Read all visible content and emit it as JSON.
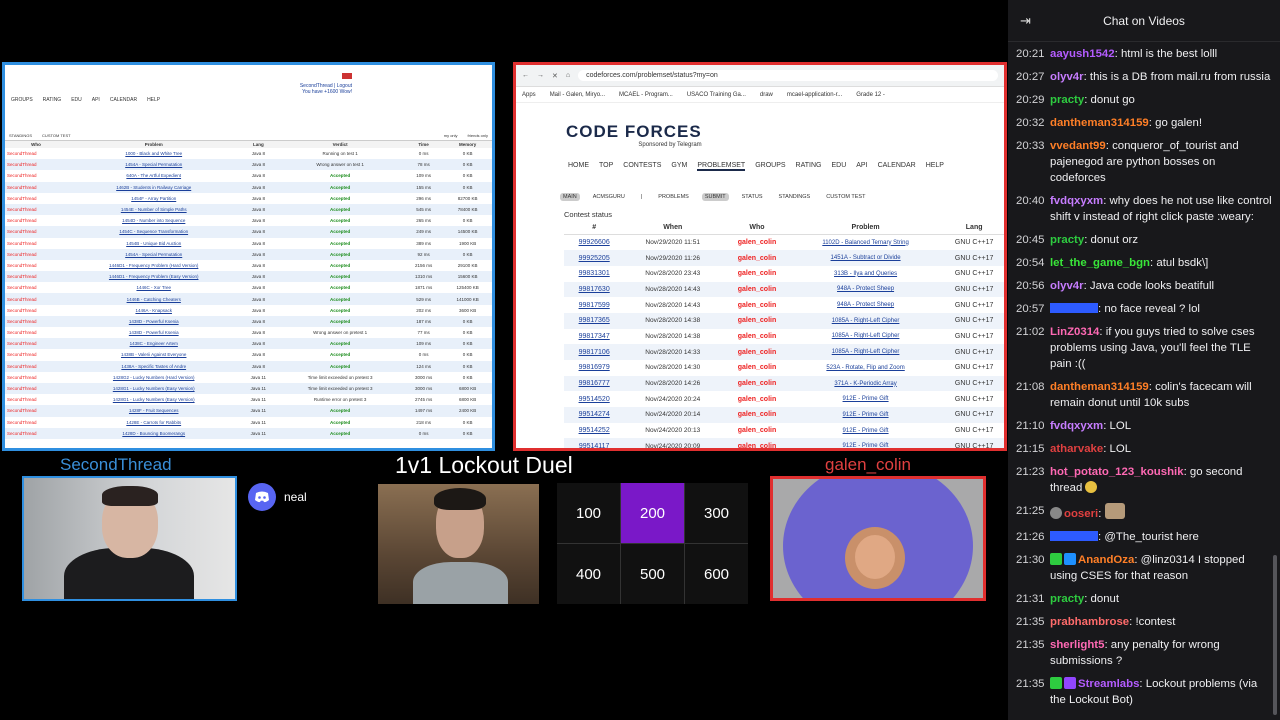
{
  "left_screen": {
    "nav": [
      "GROUPS",
      "RATING",
      "EDU",
      "API",
      "CALENDAR",
      "HELP"
    ],
    "user_lines": [
      "SecondThread | Logout",
      "You have +1600 Wow!"
    ],
    "subnav": [
      "STANDINGS",
      "CUSTOM TEST",
      "my only",
      "friends only"
    ],
    "headers": [
      "Who",
      "Problem",
      "Lang",
      "Verdict",
      "Time",
      "Memory"
    ],
    "rows": [
      [
        "SecondThread",
        "1000 - Black and White Tree",
        "Java 8",
        "Running on test 1",
        "0 ms",
        "0 KB"
      ],
      [
        "SecondThread",
        "1454A - Special Permutation",
        "Java 8",
        "Wrong answer on test 1",
        "78 ms",
        "0 KB"
      ],
      [
        "SecondThread",
        "640A - The Artful Expedient",
        "Java 8",
        "Accepted",
        "109 ms",
        "0 KB"
      ],
      [
        "SecondThread",
        "1462B - Students in Railway Carriage",
        "Java 8",
        "Accepted",
        "155 ms",
        "0 KB"
      ],
      [
        "SecondThread",
        "1454F - Array Partition",
        "Java 8",
        "Accepted",
        "296 ms",
        "82700 KB"
      ],
      [
        "SecondThread",
        "1454E - Number of Simple Paths",
        "Java 8",
        "Accepted",
        "545 ms",
        "78400 KB"
      ],
      [
        "SecondThread",
        "1454D - Number into Sequence",
        "Java 8",
        "Accepted",
        "265 ms",
        "0 KB"
      ],
      [
        "SecondThread",
        "1454C - Sequence Transformation",
        "Java 8",
        "Accepted",
        "249 ms",
        "14500 KB"
      ],
      [
        "SecondThread",
        "1454B - Unique Bid Auction",
        "Java 8",
        "Accepted",
        "389 ms",
        "1900 KB"
      ],
      [
        "SecondThread",
        "1454A - Special Permutation",
        "Java 8",
        "Accepted",
        "92 ms",
        "0 KB"
      ],
      [
        "SecondThread",
        "1446D1 - Frequency Problem (Hard Version)",
        "Java 8",
        "Accepted",
        "2156 ms",
        "29100 KB"
      ],
      [
        "SecondThread",
        "1446D1 - Frequency Problem (Easy Version)",
        "Java 8",
        "Accepted",
        "1310 ms",
        "15600 KB"
      ],
      [
        "SecondThread",
        "1446C - Xor Tree",
        "Java 8",
        "Accepted",
        "1871 ms",
        "125400 KB"
      ],
      [
        "SecondThread",
        "1446B - Catching Cheaters",
        "Java 8",
        "Accepted",
        "529 ms",
        "141000 KB"
      ],
      [
        "SecondThread",
        "1446A - Knapsack",
        "Java 8",
        "Accepted",
        "202 ms",
        "3600 KB"
      ],
      [
        "SecondThread",
        "1438D - Powerful Ksenia",
        "Java 8",
        "Accepted",
        "187 ms",
        "0 KB"
      ],
      [
        "SecondThread",
        "1438D - Powerful Ksenia",
        "Java 8",
        "Wrong answer on pretest 1",
        "77 ms",
        "0 KB"
      ],
      [
        "SecondThread",
        "1438C - Engineer Artem",
        "Java 8",
        "Accepted",
        "109 ms",
        "0 KB"
      ],
      [
        "SecondThread",
        "1438B - Valerii Against Everyone",
        "Java 8",
        "Accepted",
        "0 ms",
        "0 KB"
      ],
      [
        "SecondThread",
        "1438A - Specific Tastes of Andre",
        "Java 8",
        "Accepted",
        "124 ms",
        "0 KB"
      ],
      [
        "SecondThread",
        "1428G2 - Lucky Numbers (Hard Version)",
        "Java 11",
        "Time limit exceeded on pretest 3",
        "3000 ms",
        "0 KB"
      ],
      [
        "SecondThread",
        "1428G1 - Lucky Numbers (Easy Version)",
        "Java 11",
        "Time limit exceeded on pretest 3",
        "3000 ms",
        "6800 KB"
      ],
      [
        "SecondThread",
        "1428G1 - Lucky Numbers (Easy Version)",
        "Java 11",
        "Runtime error on pretest 3",
        "2745 ms",
        "6800 KB"
      ],
      [
        "SecondThread",
        "1428F - Fruit Sequences",
        "Java 11",
        "Accepted",
        "1497 ms",
        "2400 KB"
      ],
      [
        "SecondThread",
        "1428E - Carrots for Rabbits",
        "Java 11",
        "Accepted",
        "218 ms",
        "0 KB"
      ],
      [
        "SecondThread",
        "1428D - Bouncing Boomerangs",
        "Java 11",
        "Accepted",
        "0 ms",
        "0 KB"
      ]
    ]
  },
  "right_screen": {
    "url": "codeforces.com/problemset/status?my=on",
    "bookmarks": [
      "Apps",
      "Mail - Galen, Miryo...",
      "MCAEL - Program...",
      "USACO Training Ga...",
      "draw",
      "mcael-application-r...",
      "Grade 12 -"
    ],
    "logo": "CODE FORCES",
    "logo_sub": "Sponsored by Telegram",
    "menu": [
      "HOME",
      "TOP",
      "CONTESTS",
      "GYM",
      "PROBLEMSET",
      "GROUPS",
      "RATING",
      "EDU",
      "API",
      "CALENDAR",
      "HELP"
    ],
    "submenu": [
      "MAIN",
      "ACMSGURU",
      "|",
      "PROBLEMS",
      "SUBMIT",
      "STATUS",
      "STANDINGS",
      "CUSTOM TEST"
    ],
    "contest_status": "Contest status",
    "headers": [
      "#",
      "When",
      "Who",
      "Problem",
      "Lang"
    ],
    "rows": [
      [
        "99926606",
        "Nov/29/2020 11:51",
        "galen_colin",
        "1102D - Balanced Ternary String",
        "GNU C++17"
      ],
      [
        "99925205",
        "Nov/29/2020 11:26",
        "galen_colin",
        "1451A - Subtract or Divide",
        "GNU C++17"
      ],
      [
        "99831301",
        "Nov/28/2020 23:43",
        "galen_colin",
        "313B - Ilya and Queries",
        "GNU C++17"
      ],
      [
        "99817630",
        "Nov/28/2020 14:43",
        "galen_colin",
        "948A - Protect Sheep",
        "GNU C++17"
      ],
      [
        "99817599",
        "Nov/28/2020 14:43",
        "galen_colin",
        "948A - Protect Sheep",
        "GNU C++17"
      ],
      [
        "99817365",
        "Nov/28/2020 14:38",
        "galen_colin",
        "1085A - Right-Left Cipher",
        "GNU C++17"
      ],
      [
        "99817347",
        "Nov/28/2020 14:38",
        "galen_colin",
        "1085A - Right-Left Cipher",
        "GNU C++17"
      ],
      [
        "99817106",
        "Nov/28/2020 14:33",
        "galen_colin",
        "1085A - Right-Left Cipher",
        "GNU C++17"
      ],
      [
        "99816979",
        "Nov/28/2020 14:30",
        "galen_colin",
        "523A - Rotate, Flip and Zoom",
        "GNU C++17"
      ],
      [
        "99816777",
        "Nov/28/2020 14:26",
        "galen_colin",
        "371A - K-Periodic Array",
        "GNU C++17"
      ],
      [
        "99514520",
        "Nov/24/2020 20:24",
        "galen_colin",
        "912E - Prime Gift",
        "GNU C++17"
      ],
      [
        "99514274",
        "Nov/24/2020 20:14",
        "galen_colin",
        "912E - Prime Gift",
        "GNU C++17"
      ],
      [
        "99514252",
        "Nov/24/2020 20:13",
        "galen_colin",
        "912E - Prime Gift",
        "GNU C++17"
      ],
      [
        "99514117",
        "Nov/24/2020 20:09",
        "galen_colin",
        "912E - Prime Gift",
        "GNU C++17"
      ]
    ]
  },
  "overlay": {
    "player1": "SecondThread",
    "player2": "galen_colin",
    "title": "1v1 Lockout Duel",
    "discord_user": "neal",
    "problem_points": [
      "100",
      "200",
      "300",
      "400",
      "500",
      "600"
    ],
    "taken_color": "#7a18c8"
  },
  "chat": {
    "title": "Chat on Videos",
    "messages": [
      {
        "ts": "20:21",
        "user": "aayush1542",
        "color": "#b45cff",
        "text": "html is the best lolll"
      },
      {
        "ts": "20:27",
        "user": "olyv4r",
        "color": "#c77dff",
        "text": "this is a DB from mail.ru from russia"
      },
      {
        "ts": "20:29",
        "user": "practy",
        "color": "#2ecc40",
        "text": "donut go"
      },
      {
        "ts": "20:32",
        "user": "dantheman314159",
        "color": "#ff7f27",
        "text": "go galen!"
      },
      {
        "ts": "20:33",
        "user": "vvedant99",
        "color": "#ff7f27",
        "text": "conqueror_of_tourist and pajenegod are python bosses on codeforces"
      },
      {
        "ts": "20:40",
        "user": "fvdqxyxm",
        "color": "#c77dff",
        "text": "why does he not use like control shift v instead of right click paste :weary:"
      },
      {
        "ts": "20:45",
        "user": "practy",
        "color": "#2ecc40",
        "text": "donut orz"
      },
      {
        "ts": "20:54",
        "user": "let_the_game_bgn",
        "color": "#39e639",
        "text": "atul bsdk\\]"
      },
      {
        "ts": "20:56",
        "user": "olyv4r",
        "color": "#c77dff",
        "text": "Java code looks beatifull"
      },
      {
        "ts": "20:57",
        "user": "",
        "color": "#2d5bff",
        "text": "no face reveal ? lol"
      },
      {
        "ts": "21:02",
        "user": "LinZ0314",
        "color": "#ff69b4",
        "text": "if you guys tried to solve cses problems using Java, you'll feel the TLE pain :(("
      },
      {
        "ts": "21:08",
        "user": "dantheman314159",
        "color": "#ff7f27",
        "text": "colin's facecam will remain donut until 10k subs"
      },
      {
        "ts": "21:10",
        "user": "fvdqxyxm",
        "color": "#c77dff",
        "text": "LOL"
      },
      {
        "ts": "21:15",
        "user": "atharvake",
        "color": "#e04040",
        "text": "LOL"
      },
      {
        "ts": "21:23",
        "user": "hot_potato_123_koushik",
        "color": "#ff69b4",
        "text": "go second thread"
      },
      {
        "ts": "21:25",
        "user": "ooseri",
        "color": "#e04040",
        "text": ""
      },
      {
        "ts": "21:26",
        "user": "",
        "color": "#2d5bff",
        "text": "@The_tourist here"
      },
      {
        "ts": "21:30",
        "user": "AnandOza",
        "color": "#ff7f27",
        "text": "@linz0314 I stopped using CSES for that reason"
      },
      {
        "ts": "21:31",
        "user": "practy",
        "color": "#2ecc40",
        "text": "donut"
      },
      {
        "ts": "21:35",
        "user": "prabhambrose",
        "color": "#ff6b6b",
        "text": "!contest"
      },
      {
        "ts": "21:35",
        "user": "sherlight5",
        "color": "#ff69b4",
        "text": "any penalty for wrong submissions ?"
      },
      {
        "ts": "21:35",
        "user": "Streamlabs",
        "color": "#b45cff",
        "text": "Lockout problems (via the Lockout Bot)"
      }
    ]
  }
}
